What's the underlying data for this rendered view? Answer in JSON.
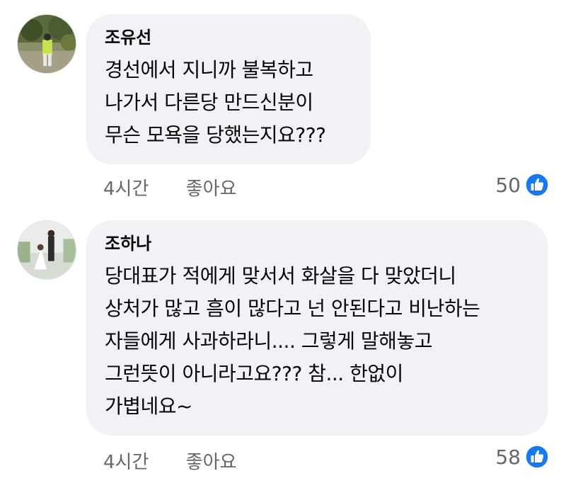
{
  "comments": [
    {
      "author": "조유선",
      "lines": [
        "경선에서 지니까 불복하고",
        "나가서 다른당 만드신분이",
        "무슨 모욕을 당했는지요???"
      ],
      "time": "4시간",
      "like_label": "좋아요",
      "reaction_count": "50"
    },
    {
      "author": "조하나",
      "lines": [
        "당대표가 적에게 맞서서 화살을 다 맞았더니",
        "상처가 많고 흠이 많다고 넌 안된다고 비난하는",
        "자들에게 사과하라니.... 그렇게 말해놓고",
        "그런뜻이 아니라고요??? 참... 한없이",
        "가볍네요~"
      ],
      "time": "4시간",
      "like_label": "좋아요",
      "reaction_count": "58"
    }
  ],
  "colors": {
    "bubble": "#f0f2f5",
    "meta_text": "#65676b",
    "like_blue": "#1877f2"
  },
  "icons": {
    "reaction": "thumbs-up-icon"
  }
}
